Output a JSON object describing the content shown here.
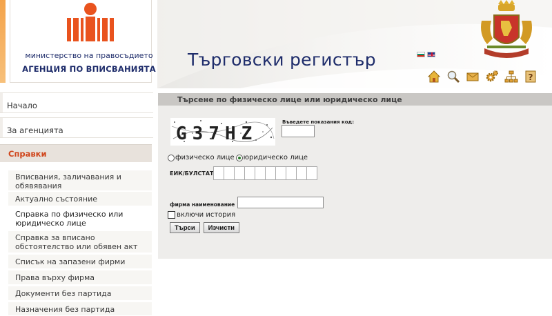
{
  "logo": {
    "ministry": "министерство на правосъдието",
    "agency": "АГЕНЦИЯ ПО ВПИСВАНИЯТА"
  },
  "banner": {
    "title": "Търговски регистър"
  },
  "toolbar": {
    "icons": [
      "home-icon",
      "search-icon",
      "mail-icon",
      "settings-icon",
      "sitemap-icon",
      "help-icon"
    ]
  },
  "nav": {
    "home": "Начало",
    "agency": "За агенцията",
    "reports": "Справки",
    "items": [
      "Вписвания, заличавания и обявявания",
      "Актуално състояние",
      "Справка по физическо или юридическо лице",
      "Справка за вписано обстоятелство или обявен акт",
      "Списък на запазени фирми",
      "Права върху фирма",
      "Документи без партида",
      "Назначения без партида"
    ]
  },
  "search": {
    "header": "Търсене по физическо лице или юридическо лице",
    "captcha_text": "G37HZ",
    "captcha_label": "Въведете показания код:",
    "radio_person": "физическо лице",
    "radio_legal": "юридическо лице",
    "eik_label": "ЕИК/БУЛСТАТ",
    "firm_label": "фирма наименование",
    "include_history": "включи история",
    "search_button": "Търси",
    "clear_button": "Изчисти"
  }
}
